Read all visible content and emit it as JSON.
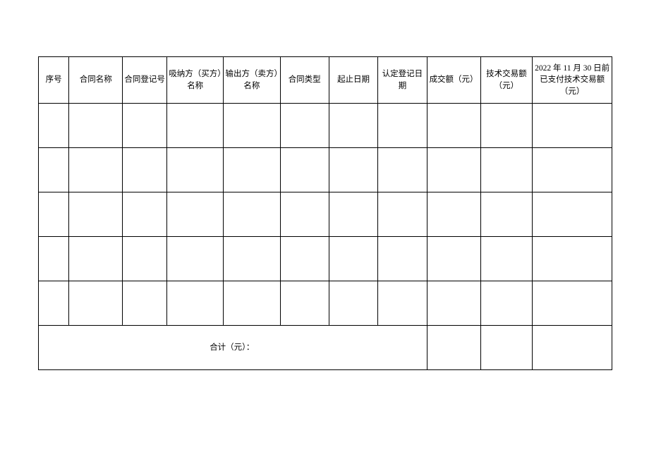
{
  "table": {
    "headers": [
      "序号",
      "合同名称",
      "合同登记号",
      "吸纳方（买方）名称",
      "输出方（卖方）名称",
      "合同类型",
      "起止日期",
      "认定登记日期",
      "成交额（元）",
      "技术交易额（元）",
      "2022 年 11 月 30 日前已支付技术交易额（元）"
    ],
    "rows": [
      [
        "",
        "",
        "",
        "",
        "",
        "",
        "",
        "",
        "",
        "",
        ""
      ],
      [
        "",
        "",
        "",
        "",
        "",
        "",
        "",
        "",
        "",
        "",
        ""
      ],
      [
        "",
        "",
        "",
        "",
        "",
        "",
        "",
        "",
        "",
        "",
        ""
      ],
      [
        "",
        "",
        "",
        "",
        "",
        "",
        "",
        "",
        "",
        "",
        ""
      ],
      [
        "",
        "",
        "",
        "",
        "",
        "",
        "",
        "",
        "",
        "",
        ""
      ]
    ],
    "total_label": "合计（元）：",
    "total_values": [
      "",
      "",
      ""
    ]
  }
}
